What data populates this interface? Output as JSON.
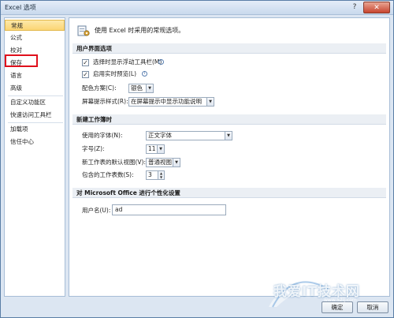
{
  "window": {
    "title": "Excel 选项",
    "help_glyph": "?",
    "close_glyph": "✕"
  },
  "sidebar": {
    "items": [
      {
        "label": "常规",
        "selected": true
      },
      {
        "label": "公式"
      },
      {
        "label": "校对"
      },
      {
        "label": "保存"
      },
      {
        "label": "语言"
      },
      {
        "label": "高级"
      },
      {
        "label": "自定义功能区"
      },
      {
        "label": "快速访问工具栏"
      },
      {
        "label": "加载项"
      },
      {
        "label": "信任中心"
      }
    ]
  },
  "content": {
    "intro": "使用 Excel 时采用的常规选项。",
    "ui_section": {
      "header": "用户界面选项",
      "mini_toolbar_label": "选择时显示浮动工具栏(M)",
      "mini_toolbar_checked": true,
      "live_preview_label": "启用实时预览(L)",
      "live_preview_checked": true,
      "color_scheme_label": "配色方案(C):",
      "color_scheme_value": "银色",
      "screentip_label": "屏幕提示样式(R):",
      "screentip_value": "在屏幕提示中显示功能说明"
    },
    "workbook_section": {
      "header": "新建工作簿时",
      "font_label": "使用的字体(N):",
      "font_value": "正文字体",
      "size_label": "字号(Z):",
      "size_value": "11",
      "view_label": "新工作表的默认视图(V):",
      "view_value": "普通视图",
      "sheets_label": "包含的工作表数(S):",
      "sheets_value": "3"
    },
    "personalize_section": {
      "header": "对 Microsoft Office 进行个性化设置",
      "username_label": "用户名(U):",
      "username_value": "ad"
    }
  },
  "buttons": {
    "ok": "确定",
    "cancel": "取消"
  },
  "watermark": {
    "text": "我爱IT技术网",
    "url": "www.52ij.com"
  },
  "colors": {
    "selected_bg": "#fbd574",
    "highlight_box": "#e0101c",
    "close_btn": "#c8452f"
  }
}
